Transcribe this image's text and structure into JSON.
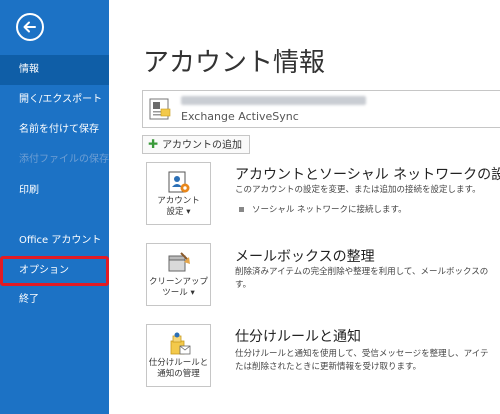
{
  "sidebar": {
    "items": [
      {
        "label": "情報"
      },
      {
        "label": "開く/エクスポート"
      },
      {
        "label": "名前を付けて保存"
      },
      {
        "label": "添付ファイルの保存"
      },
      {
        "label": "印刷"
      },
      {
        "label": "Office アカウント"
      },
      {
        "label": "オプション"
      },
      {
        "label": "終了"
      }
    ]
  },
  "main": {
    "title": "アカウント情報",
    "account": {
      "type": "Exchange ActiveSync"
    },
    "add_account_label": "アカウントの追加",
    "sections": [
      {
        "tile_label_1": "アカウント",
        "tile_label_2": "設定 ▾",
        "title": "アカウントとソーシャル ネットワークの設定",
        "desc_1": "このアカウントの設定を変更、または追加の接続を設定します。",
        "bullet": "ソーシャル ネットワークに接続します。"
      },
      {
        "tile_label_1": "クリーンアップ",
        "tile_label_2": "ツール ▾",
        "title": "メールボックスの整理",
        "desc_1": "削除済みアイテムの完全削除や整理を利用して、メールボックスの",
        "desc_2": "す。"
      },
      {
        "tile_label_1": "仕分けルールと",
        "tile_label_2": "通知の管理",
        "title": "仕分けルールと通知",
        "desc_1": "仕分けルールと通知を使用して、受信メッセージを整理し、アイテ",
        "desc_2": "たは削除されたときに更新情報を受け取ります。"
      }
    ]
  },
  "colors": {
    "sidebar": "#1c72c5",
    "sidebar_active": "#0f5ea7",
    "highlight": "#e21b24"
  }
}
